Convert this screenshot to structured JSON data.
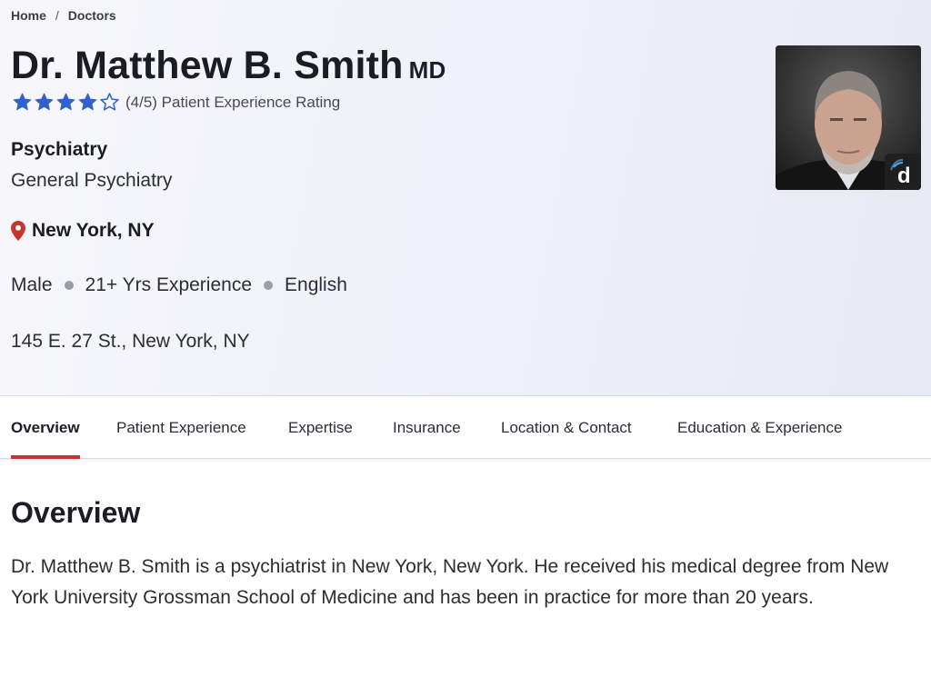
{
  "breadcrumb": {
    "home": "Home",
    "separator": "/",
    "current": "Doctors"
  },
  "doctor": {
    "name": "Dr. Matthew B. Smith",
    "credential": "MD",
    "rating": {
      "value": 4,
      "max": 5,
      "text": "(4/5) Patient Experience Rating"
    },
    "specialty": "Psychiatry",
    "subspecialty": "General Psychiatry",
    "location": "New York, NY",
    "gender": "Male",
    "experience": "21+ Yrs Experience",
    "language": "English",
    "address": "145 E. 27 St., New York, NY",
    "photo_badge_icon": "doximity-d-icon"
  },
  "tabs": [
    {
      "label": "Overview",
      "active": true
    },
    {
      "label": "Patient Experience",
      "active": false
    },
    {
      "label": "Expertise",
      "active": false
    },
    {
      "label": "Insurance",
      "active": false
    },
    {
      "label": "Location & Contact",
      "active": false
    },
    {
      "label": "Education & Experience",
      "active": false
    }
  ],
  "overview": {
    "title": "Overview",
    "body": "Dr. Matthew B. Smith is a psychiatrist in New York, New York. He received his medical degree from New York University Grossman School of Medicine and has been in practice for more than 20 years."
  },
  "colors": {
    "star": "#2f5fd1",
    "pin": "#c8342c",
    "tab_active_underline": "#c8342c"
  }
}
